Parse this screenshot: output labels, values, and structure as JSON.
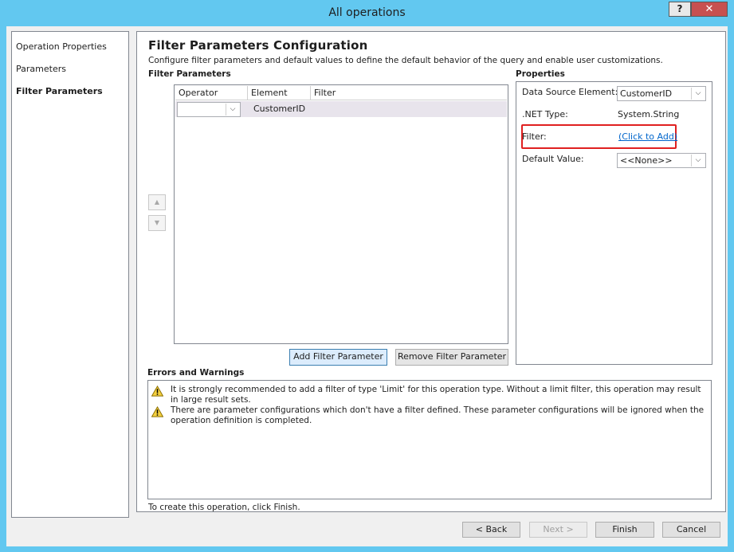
{
  "window": {
    "title": "All operations",
    "help_label": "?",
    "close_label": "✕"
  },
  "nav": {
    "items": [
      {
        "label": "Operation Properties",
        "active": false
      },
      {
        "label": "Parameters",
        "active": false
      },
      {
        "label": "Filter Parameters",
        "active": true
      }
    ]
  },
  "main": {
    "title": "Filter Parameters Configuration",
    "description": "Configure filter parameters and default values to define the default behavior of the query and enable user customizations."
  },
  "filter_params": {
    "section_label": "Filter Parameters",
    "columns": [
      "Operator",
      "Element",
      "Filter"
    ],
    "rows": [
      {
        "operator": "",
        "element": "CustomerID",
        "filter": ""
      }
    ],
    "add_button": "Add Filter Parameter",
    "remove_button": "Remove Filter Parameter",
    "up_icon": "arrow-up-icon",
    "down_icon": "arrow-down-icon"
  },
  "properties": {
    "section_label": "Properties",
    "data_source_label": "Data Source Element:",
    "data_source_value": "CustomerID",
    "net_type_label": ".NET Type:",
    "net_type_value": "System.String",
    "filter_label": "Filter:",
    "filter_link": "(Click to Add)",
    "default_value_label": "Default Value:",
    "default_value": "<<None>>",
    "highlight_color": "#e02020"
  },
  "errors": {
    "section_label": "Errors and Warnings",
    "items": [
      {
        "icon": "warning-icon",
        "text": "It is strongly recommended to add a filter of type 'Limit' for this operation type. Without a limit filter, this operation may result in large result sets."
      },
      {
        "icon": "warning-icon",
        "text": "There are parameter configurations which don't have a filter defined. These parameter configurations will be ignored when the operation definition is completed."
      }
    ]
  },
  "footer": {
    "hint": "To create this operation, click Finish."
  },
  "buttons": {
    "back": "< Back",
    "next": "Next >",
    "finish": "Finish",
    "cancel": "Cancel"
  }
}
